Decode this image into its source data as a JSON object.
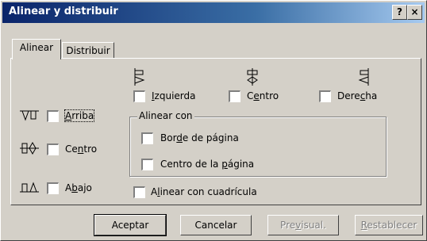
{
  "window": {
    "title": "Alinear y distribuir",
    "help_button": "?",
    "close_button": "×"
  },
  "tabs": [
    {
      "label": "Alinear",
      "active": true
    },
    {
      "label": "Distribuir",
      "active": false
    }
  ],
  "horizontal": {
    "left": {
      "prefix": "",
      "u": "I",
      "rest": "zquierda",
      "checked": false,
      "icon": "align-left-icon"
    },
    "center": {
      "prefix": "C",
      "u": "e",
      "rest": "ntro",
      "checked": false,
      "icon": "align-center-horizontal-icon"
    },
    "right": {
      "prefix": "Dere",
      "u": "c",
      "rest": "ha",
      "checked": false,
      "icon": "align-right-icon"
    }
  },
  "vertical": {
    "top": {
      "prefix": "",
      "u": "A",
      "rest": "rriba",
      "checked": false,
      "icon": "align-top-icon"
    },
    "center": {
      "prefix": "Ce",
      "u": "n",
      "rest": "tro",
      "checked": false,
      "icon": "align-middle-vertical-icon"
    },
    "bottom": {
      "prefix": "A",
      "u": "b",
      "rest": "ajo",
      "checked": false,
      "icon": "align-bottom-icon"
    }
  },
  "align_with": {
    "legend": "Alinear con",
    "page_border": {
      "prefix": "Bor",
      "u": "d",
      "rest": "e de página",
      "checked": false
    },
    "page_center": {
      "prefix": "Centro de la ",
      "u": "p",
      "rest": "ágina",
      "checked": false
    }
  },
  "grid": {
    "prefix": "A",
    "u": "l",
    "rest": "inear con cuadrícula",
    "checked": false
  },
  "buttons": {
    "ok": "Aceptar",
    "cancel": "Cancelar",
    "preview": {
      "prefix": "Pre",
      "u": "v",
      "rest": "isual.",
      "disabled": true
    },
    "reset": {
      "prefix": "",
      "u": "R",
      "rest": "establecer",
      "disabled": true
    }
  }
}
